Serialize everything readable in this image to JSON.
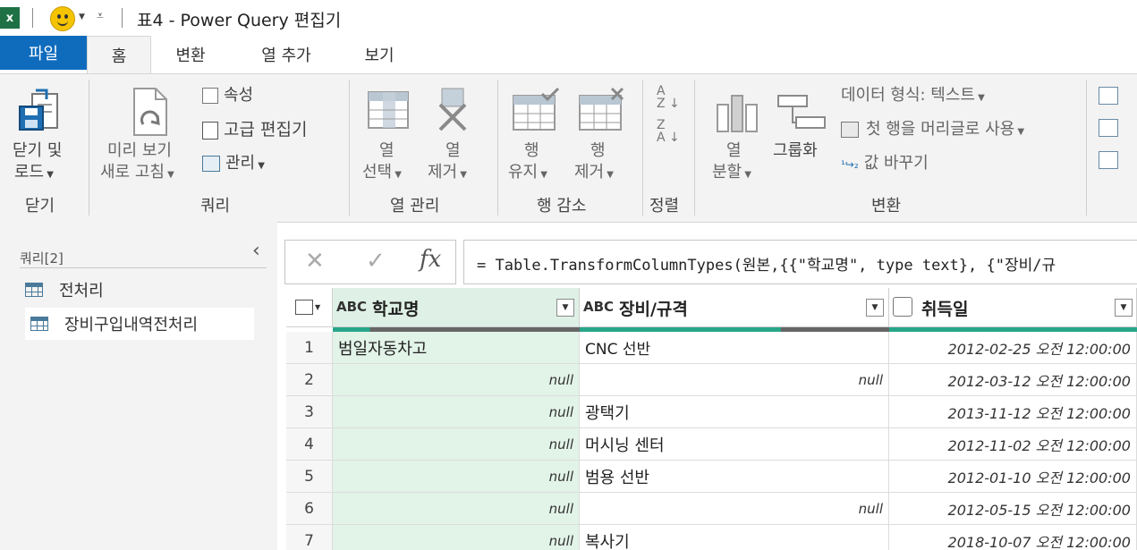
{
  "app": {
    "title": "표4 - Power Query 편집기",
    "logo_label": "x"
  },
  "tabs": [
    {
      "label": "파일"
    },
    {
      "label": "홈"
    },
    {
      "label": "변환"
    },
    {
      "label": "열 추가"
    },
    {
      "label": "보기"
    }
  ],
  "ribbon": {
    "close_load_1": "닫기 및",
    "close_load_2": "로드",
    "refresh_1": "미리 보기",
    "refresh_2": "새로 고침",
    "properties": "속성",
    "advanced_editor": "고급 편집기",
    "manage": "관리",
    "choose_cols_1": "열",
    "choose_cols_2": "선택",
    "remove_cols_1": "열",
    "remove_cols_2": "제거",
    "keep_rows_1": "행",
    "keep_rows_2": "유지",
    "remove_rows_1": "행",
    "remove_rows_2": "제거",
    "split_1": "열",
    "split_2": "분할",
    "group_by": "그룹화",
    "data_type": "데이터 형식: 텍스트",
    "first_row_header": "첫 행을 머리글로 사용",
    "replace_values": "값 바꾸기",
    "groups": {
      "close": "닫기",
      "query": "쿼리",
      "manage_cols": "열 관리",
      "reduce_rows": "행 감소",
      "sort": "정렬",
      "transform": "변환"
    }
  },
  "queries": {
    "header": "쿼리[2]",
    "items": [
      {
        "label": "전처리"
      },
      {
        "label": "장비구입내역전처리"
      }
    ]
  },
  "formula": {
    "text": "= Table.TransformColumnTypes(원본,{{\"학교명\", type text}, {\"장비/규"
  },
  "grid": {
    "columns": [
      {
        "title": "학교명"
      },
      {
        "title": "장비/규격"
      },
      {
        "title": "취득일"
      }
    ],
    "type_label": "ABC",
    "rows": [
      {
        "n": "1",
        "school": "범일자동차고",
        "equip": "CNC 선반",
        "date": "2012-02-25 오전 12:00:00"
      },
      {
        "n": "2",
        "school": "null",
        "equip": "null",
        "date": "2012-03-12 오전 12:00:00"
      },
      {
        "n": "3",
        "school": "null",
        "equip": "광택기",
        "date": "2013-11-12 오전 12:00:00"
      },
      {
        "n": "4",
        "school": "null",
        "equip": "머시닝 센터",
        "date": "2012-11-02 오전 12:00:00"
      },
      {
        "n": "5",
        "school": "null",
        "equip": "범용 선반",
        "date": "2012-01-10 오전 12:00:00"
      },
      {
        "n": "6",
        "school": "null",
        "equip": "null",
        "date": "2012-05-15 오전 12:00:00"
      },
      {
        "n": "7",
        "school": "null",
        "equip": "복사기",
        "date": "2018-10-07 오전 12:00:00"
      }
    ]
  },
  "colors": {
    "file_tab": "#0f6cbd",
    "selected_column": "#e2f3e8",
    "quality_bar": "#27a68a"
  }
}
